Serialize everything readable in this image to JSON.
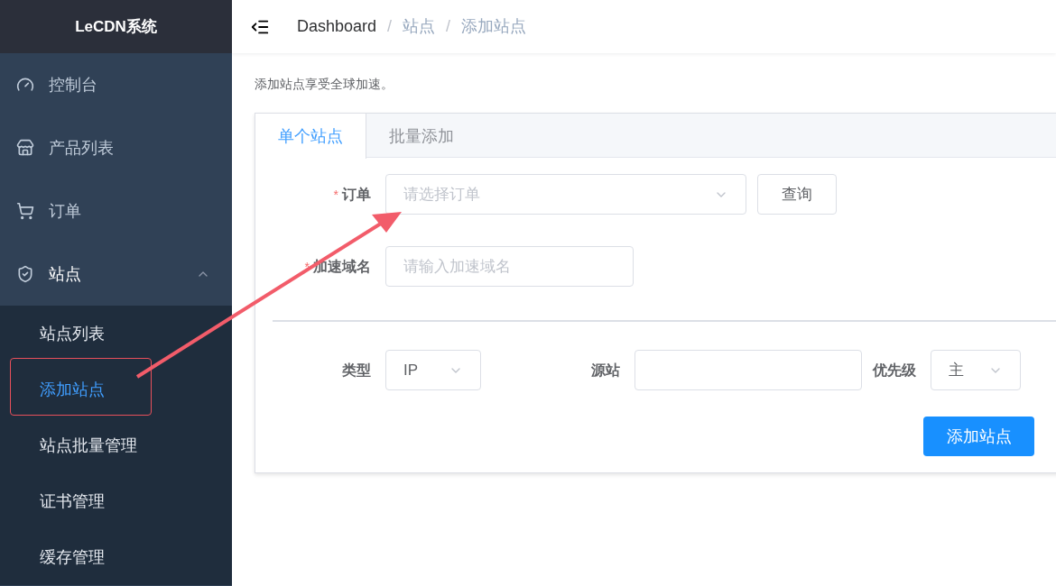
{
  "sidebar": {
    "title": "LeCDN系统",
    "items": [
      {
        "label": "控制台"
      },
      {
        "label": "产品列表"
      },
      {
        "label": "订单"
      },
      {
        "label": "站点",
        "expanded": true,
        "children": [
          {
            "label": "站点列表",
            "selected": false
          },
          {
            "label": "添加站点",
            "selected": true
          },
          {
            "label": "站点批量管理",
            "selected": false
          },
          {
            "label": "证书管理",
            "selected": false
          },
          {
            "label": "缓存管理",
            "selected": false
          }
        ]
      }
    ]
  },
  "breadcrumb": [
    "Dashboard",
    "站点",
    "添加站点"
  ],
  "breadcrumb_separator": "/",
  "intro": "添加站点享受全球加速。",
  "tabs": [
    {
      "label": "单个站点",
      "selected": true
    },
    {
      "label": "批量添加",
      "selected": false
    }
  ],
  "order": {
    "label": "订单",
    "required_mark": "*",
    "placeholder": "请选择订单",
    "button": "查询"
  },
  "domain": {
    "label": "加速域名",
    "required_mark": "*",
    "placeholder": "请输入加速域名"
  },
  "origin_row": {
    "type": {
      "label": "类型",
      "value": "IP"
    },
    "source": {
      "label": "源站"
    },
    "priority": {
      "label": "优先级",
      "value": "主"
    }
  },
  "submit": "添加站点"
}
